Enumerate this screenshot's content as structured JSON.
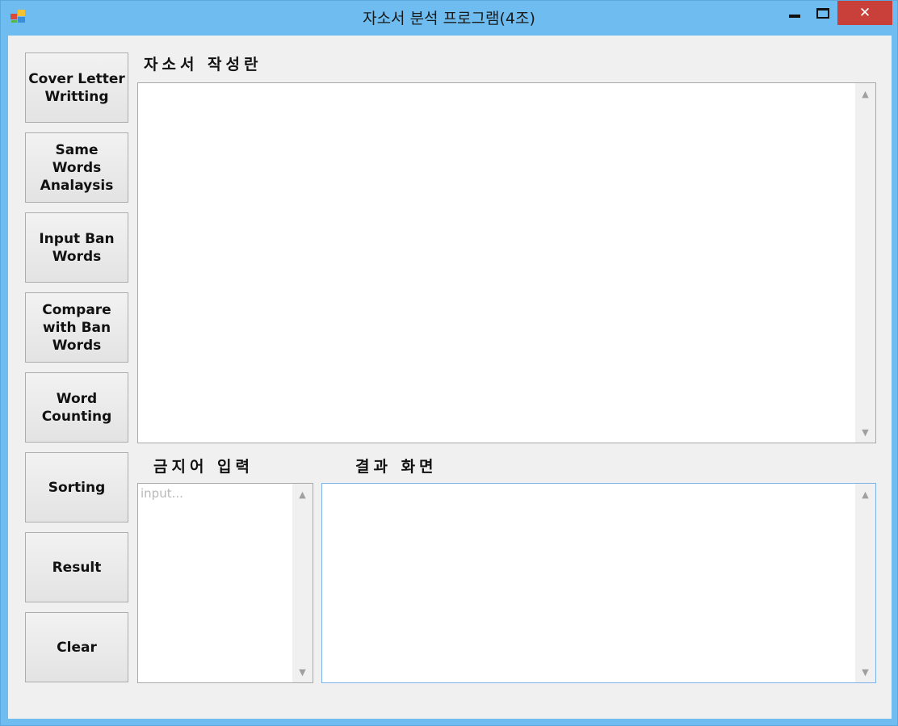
{
  "window": {
    "title": "자소서 분석 프로그램(4조)",
    "close_glyph": "✕",
    "colors": {
      "titlebar": "#6fbdf0",
      "close": "#c9403a",
      "client": "#f0f0f0"
    }
  },
  "buttons": [
    {
      "label": "Cover Letter\nWritting"
    },
    {
      "label": "Same\nWords\nAnalaysis"
    },
    {
      "label": "Input Ban\nWords"
    },
    {
      "label": "Compare\nwith Ban\nWords"
    },
    {
      "label": "Word\nCounting"
    },
    {
      "label": "Sorting"
    },
    {
      "label": "Result"
    },
    {
      "label": "Clear"
    }
  ],
  "labels": {
    "writing_area": "자소서 작성란",
    "ban_words_input": "금지어 입력",
    "result_screen": "결과 화면"
  },
  "ban_words_box": {
    "placeholder": "input..."
  },
  "icons": {
    "scroll_up": "▲",
    "scroll_down": "▼"
  }
}
